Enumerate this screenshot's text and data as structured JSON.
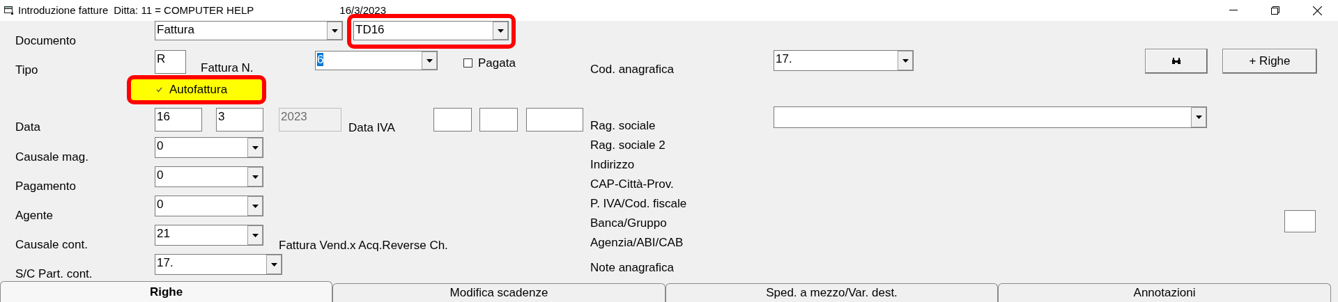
{
  "window": {
    "title": "Introduzione fatture",
    "company": "Ditta: 11 = COMPUTER HELP",
    "date": "16/3/2023"
  },
  "documento": {
    "label": "Documento",
    "tipo_doc": {
      "value": "Fattura"
    },
    "codice": {
      "value": "TD16",
      "highlighted": true
    }
  },
  "tipo": {
    "label": "Tipo",
    "value": "R"
  },
  "fattura_n": {
    "label": "Fattura N.",
    "value": "6"
  },
  "pagata": {
    "label": "Pagata",
    "checked": false
  },
  "autofattura": {
    "label": "Autofattura",
    "checked": true,
    "highlighted": true
  },
  "data": {
    "label": "Data",
    "day": "16",
    "month": "3",
    "year": {
      "value": "2023",
      "disabled": true
    }
  },
  "data_iva": {
    "label": "Data IVA"
  },
  "causale_mag": {
    "label": "Causale mag.",
    "value": "0"
  },
  "pagamento": {
    "label": "Pagamento",
    "value": "0"
  },
  "agente": {
    "label": "Agente",
    "value": "0"
  },
  "causale_cont": {
    "label": "Causale cont.",
    "value": "21",
    "description": "Fattura Vend.x Acq.Reverse Ch."
  },
  "sc_part_cont": {
    "label": "S/C Part. cont.",
    "value": "17."
  },
  "cod_anagrafica": {
    "label": "Cod. anagrafica",
    "value": "17."
  },
  "anagrafica_labels": [
    "Rag. sociale",
    "Rag. sociale 2",
    "Indirizzo",
    "CAP-Città-Prov.",
    "P. IVA/Cod. fiscale",
    "Banca/Gruppo",
    "Agenzia/ABI/CAB",
    "Note anagrafica"
  ],
  "buttons": {
    "add_rows": "+ Righe"
  },
  "tabs": [
    {
      "label": "Righe",
      "selected": true
    },
    {
      "label": "Modifica scadenze",
      "selected": false
    },
    {
      "label": "Sped. a mezzo/Var. dest.",
      "selected": false
    },
    {
      "label": "Annotazioni",
      "selected": false
    }
  ]
}
